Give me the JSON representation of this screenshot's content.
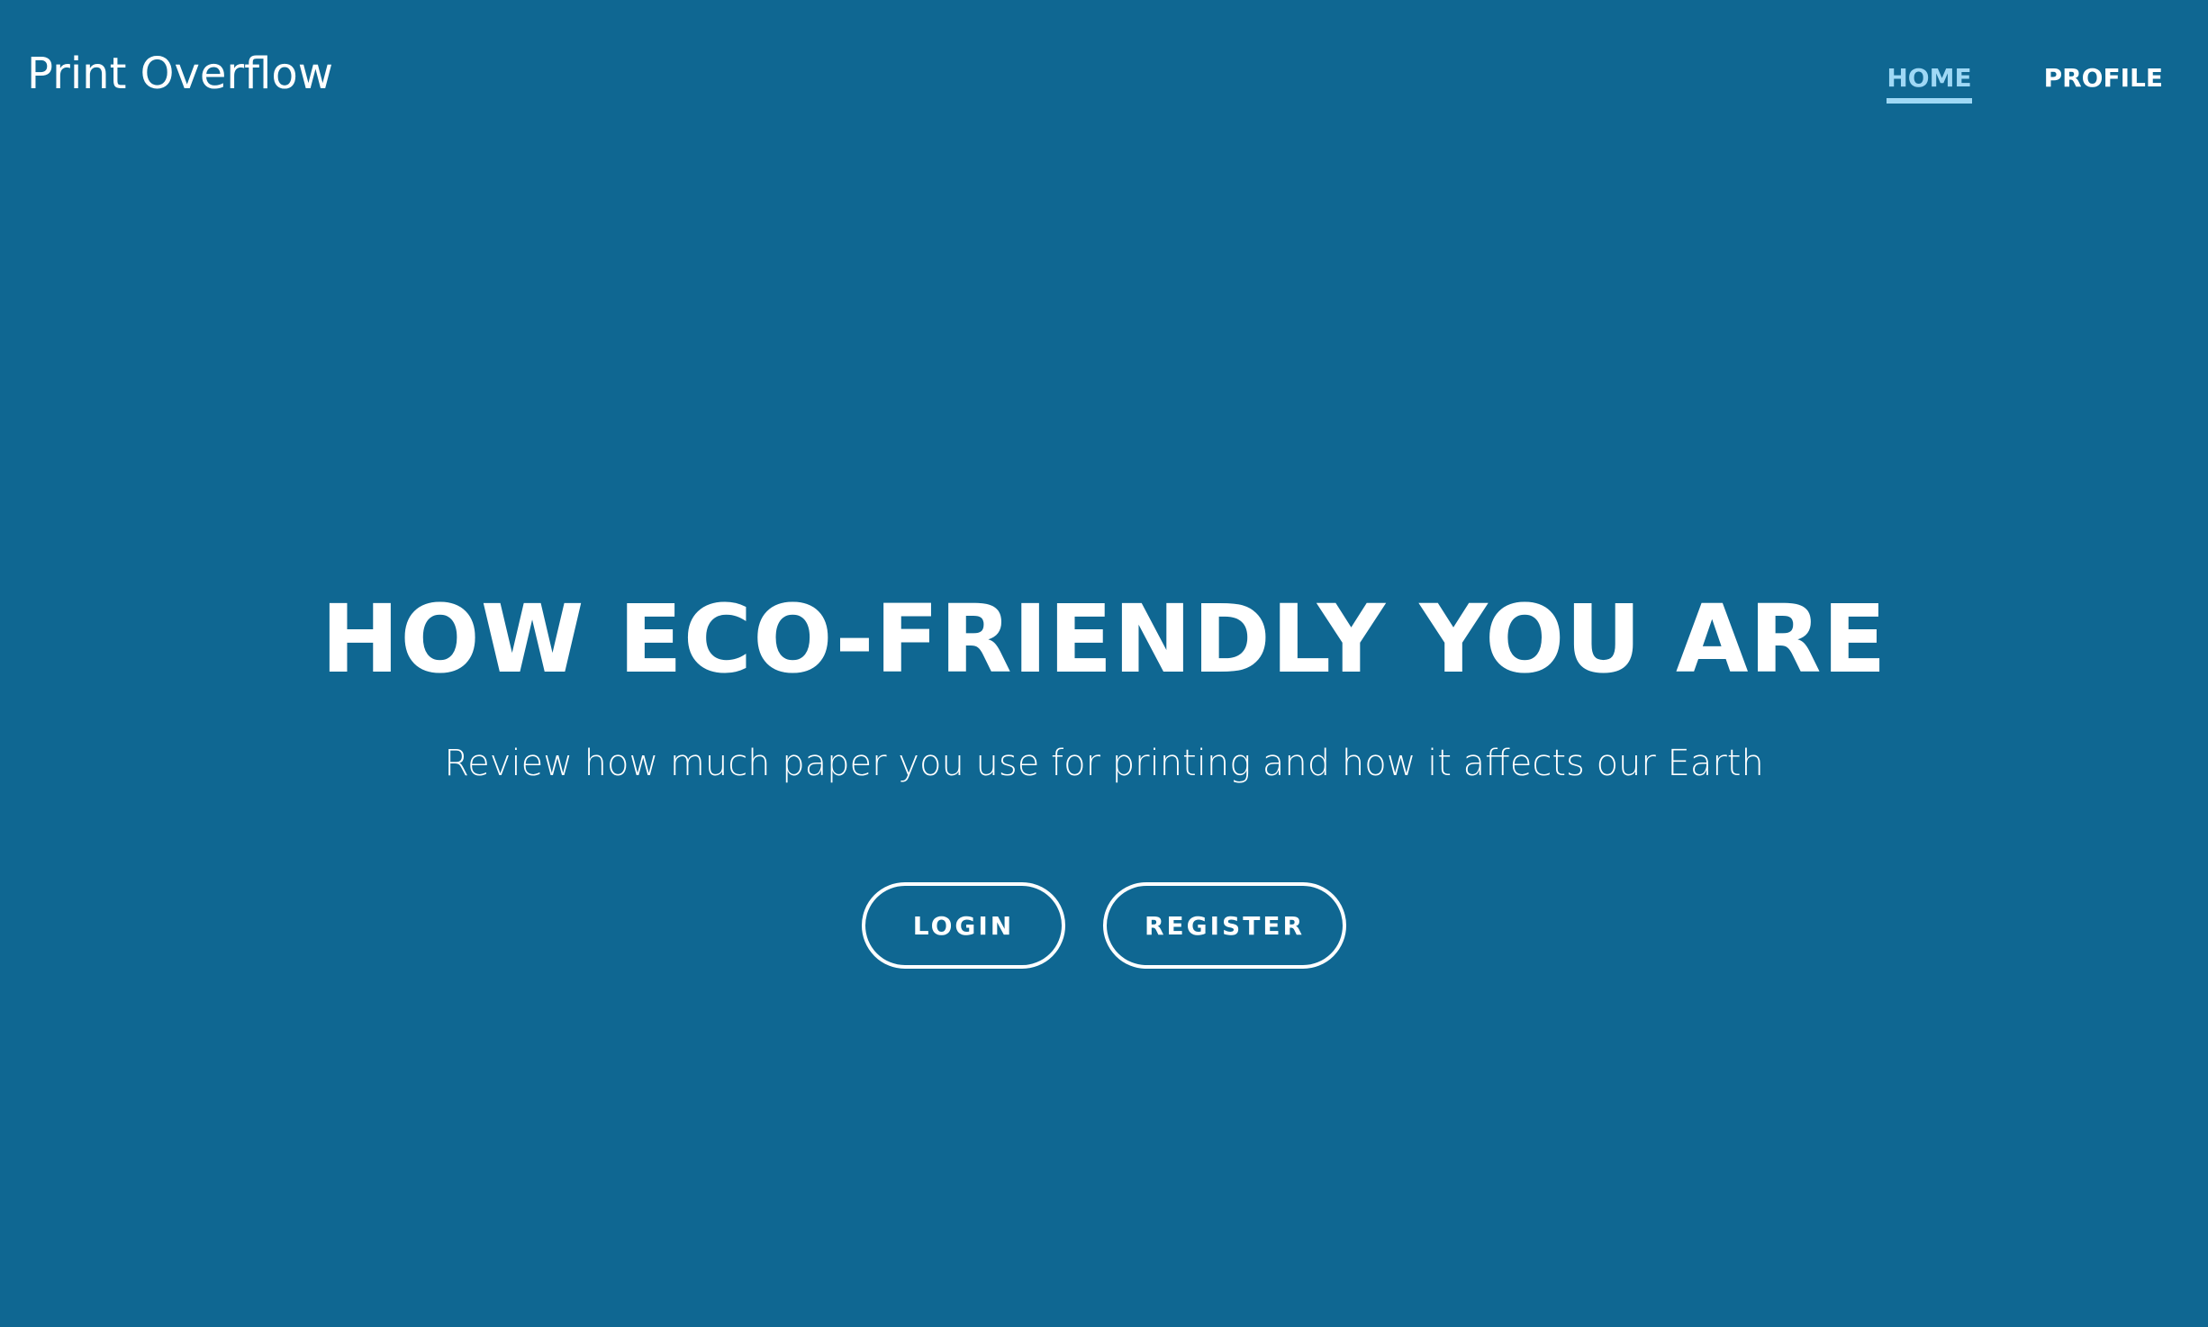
{
  "navbar": {
    "brand": "Print Overflow",
    "links": [
      {
        "label": "HOME",
        "active": true
      },
      {
        "label": "PROFILE",
        "active": false
      }
    ]
  },
  "hero": {
    "title": "HOW ECO-FRIENDLY YOU ARE",
    "subtitle": "Review how much paper you use for printing and how it affects our Earth",
    "buttons": {
      "login": "LOGIN",
      "register": "REGISTER"
    }
  },
  "colors": {
    "background": "#0f6792",
    "text": "#ffffff",
    "active_link": "#9fd8f5"
  }
}
